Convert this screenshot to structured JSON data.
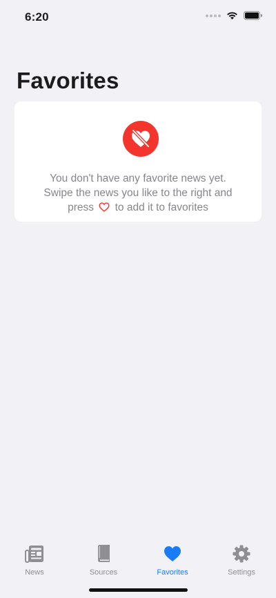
{
  "status_bar": {
    "time": "6:20"
  },
  "page": {
    "title": "Favorites"
  },
  "empty_state": {
    "icon": "heart-slash-icon",
    "line1": "You don't have any favorite news yet.",
    "line2": "Swipe the news you like to the right and",
    "line3_before": "press",
    "line3_icon": "heart-outline-icon",
    "line3_after": "to add it to favorites"
  },
  "tabs": [
    {
      "label": "News",
      "icon": "newspaper-icon",
      "active": false
    },
    {
      "label": "Sources",
      "icon": "book-icon",
      "active": false
    },
    {
      "label": "Favorites",
      "icon": "heart-icon",
      "active": true
    },
    {
      "label": "Settings",
      "icon": "gear-icon",
      "active": false
    }
  ],
  "colors": {
    "background": "#f2f1f6",
    "card": "#ffffff",
    "accent": "#1a7cf5",
    "alert_red": "#f3352e",
    "inactive_gray": "#8e8e93"
  }
}
